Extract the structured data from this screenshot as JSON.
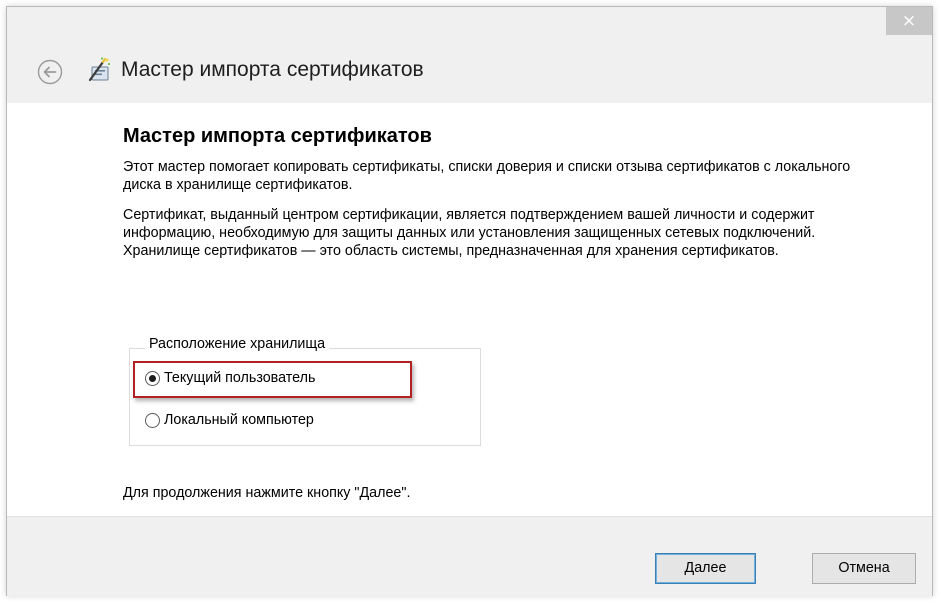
{
  "window": {
    "title": "Мастер импорта сертификатов",
    "close_glyph": "×",
    "icons": {
      "back": "back-arrow-icon",
      "wizard": "certificate-wizard-icon",
      "close": "close-icon"
    }
  },
  "content": {
    "heading": "Мастер импорта сертификатов",
    "paragraphs": [
      "Этот мастер помогает копировать сертификаты, списки доверия и списки отзыва сертификатов с локального диска в хранилище сертификатов.",
      "Сертификат, выданный центром сертификации, является подтверждением вашей личности и содержит информацию, необходимую для защиты данных или установления защищенных сетевых подключений. Хранилище сертификатов — это область системы, предназначенная для хранения сертификатов."
    ],
    "store_location": {
      "legend": "Расположение хранилища",
      "options": [
        {
          "label": "Текущий пользователь",
          "selected": true
        },
        {
          "label": "Локальный компьютер",
          "selected": false
        }
      ]
    },
    "continue_hint": "Для продолжения нажмите кнопку \"Далее\"."
  },
  "footer": {
    "next_label": "Далее",
    "cancel_label": "Отмена"
  },
  "colors": {
    "highlight_border": "#b22222",
    "primary_button_border": "#3c7fb1",
    "titlebar_bg": "#f0f0f0",
    "close_button_bg": "#c7c7c7"
  }
}
